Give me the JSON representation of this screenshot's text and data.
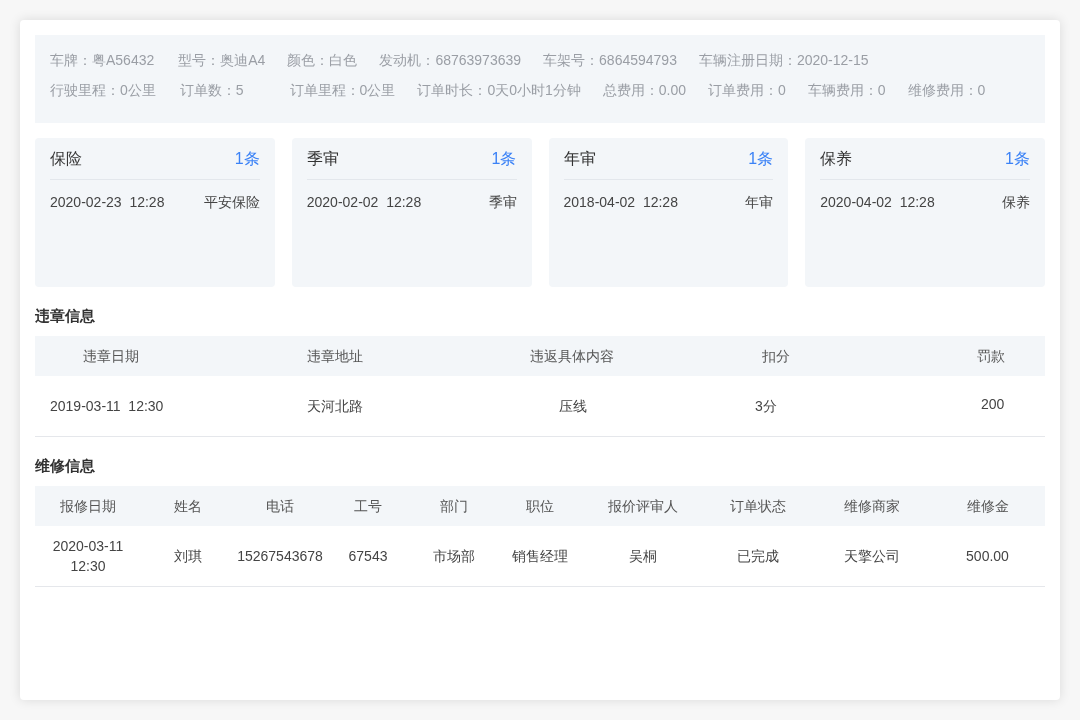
{
  "vehicle_info": {
    "rows": [
      [
        "车牌：粤A56432",
        "型号：奥迪A4",
        "颜色：白色",
        "发动机：68763973639",
        "车架号：6864594793",
        "车辆注册日期：2020-12-15"
      ],
      [
        "行驶里程：0公里",
        "订单数：5",
        "订单里程：0公里",
        "订单时长：0天0小时1分钟",
        "总费用：0.00",
        "订单费用：0",
        "车辆费用：0",
        "维修费用：0"
      ]
    ]
  },
  "cards": [
    {
      "title": "保险",
      "count": "1条",
      "datetime": "2020-02-23  12:28",
      "type": "平安保险"
    },
    {
      "title": "季审",
      "count": "1条",
      "datetime": "2020-02-02  12:28",
      "type": "季审"
    },
    {
      "title": "年审",
      "count": "1条",
      "datetime": "2018-04-02  12:28",
      "type": "年审"
    },
    {
      "title": "保养",
      "count": "1条",
      "datetime": "2020-04-02  12:28",
      "type": "保养"
    }
  ],
  "violations": {
    "title": "违章信息",
    "columns": [
      "违章日期",
      "违章地址",
      "违返具体内容",
      "扣分",
      "罚款"
    ],
    "rows": [
      [
        "2019-03-11  12:30",
        "天河北路",
        "压线",
        "3分",
        "200"
      ]
    ]
  },
  "repairs": {
    "title": "维修信息",
    "columns": [
      "报修日期",
      "姓名",
      "电话",
      "工号",
      "部门",
      "职位",
      "报价评审人",
      "订单状态",
      "维修商家",
      "维修金"
    ],
    "rows": [
      [
        "2020-03-11 12:30",
        "刘琪",
        "15267543678",
        "67543",
        "市场部",
        "销售经理",
        "吴桐",
        "已完成",
        "天擎公司",
        "500.00"
      ]
    ]
  }
}
